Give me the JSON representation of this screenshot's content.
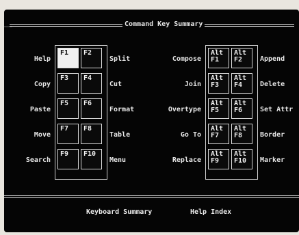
{
  "title": "Command Key Summary",
  "left_keys": [
    {
      "left_label": "Help",
      "key_a": "F1",
      "key_b": "F2",
      "right_label": "Split",
      "highlight_a": true
    },
    {
      "left_label": "Copy",
      "key_a": "F3",
      "key_b": "F4",
      "right_label": "Cut"
    },
    {
      "left_label": "Paste",
      "key_a": "F5",
      "key_b": "F6",
      "right_label": "Format"
    },
    {
      "left_label": "Move",
      "key_a": "F7",
      "key_b": "F8",
      "right_label": "Table"
    },
    {
      "left_label": "Search",
      "key_a": "F9",
      "key_b": "F10",
      "right_label": "Menu"
    }
  ],
  "right_keys": [
    {
      "left_label": "Compose",
      "key_a": "Alt\nF1",
      "key_b": "Alt\nF2",
      "right_label": "Append"
    },
    {
      "left_label": "Join",
      "key_a": "Alt\nF3",
      "key_b": "Alt\nF4",
      "right_label": "Delete"
    },
    {
      "left_label": "Overtype",
      "key_a": "Alt\nF5",
      "key_b": "Alt\nF6",
      "right_label": "Set Attr"
    },
    {
      "left_label": "Go To",
      "key_a": "Alt\nF7",
      "key_b": "Alt\nF8",
      "right_label": "Border"
    },
    {
      "left_label": "Replace",
      "key_a": "Alt\nF9",
      "key_b": "Alt\nF10",
      "right_label": "Marker"
    }
  ],
  "footer": {
    "keyboard_summary": "Keyboard Summary",
    "help_index": "Help Index"
  },
  "colors": {
    "screen": "#050505",
    "text": "#e6e6e6",
    "highlight": "#f0f0f0"
  }
}
